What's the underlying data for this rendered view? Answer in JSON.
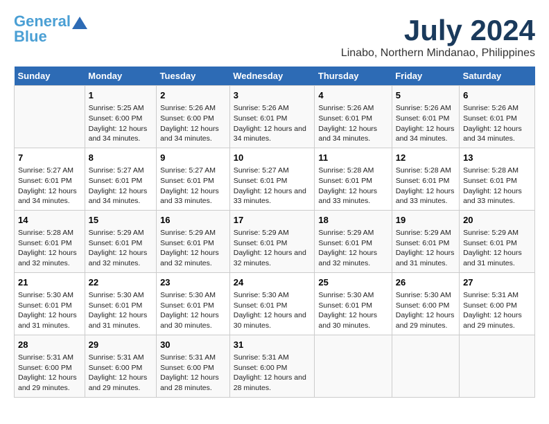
{
  "logo": {
    "line1": "General",
    "line2": "Blue"
  },
  "title": "July 2024",
  "subtitle": "Linabo, Northern Mindanao, Philippines",
  "days_header": [
    "Sunday",
    "Monday",
    "Tuesday",
    "Wednesday",
    "Thursday",
    "Friday",
    "Saturday"
  ],
  "weeks": [
    [
      {
        "day": "",
        "content": ""
      },
      {
        "day": "1",
        "content": "Sunrise: 5:25 AM\nSunset: 6:00 PM\nDaylight: 12 hours\nand 34 minutes."
      },
      {
        "day": "2",
        "content": "Sunrise: 5:26 AM\nSunset: 6:00 PM\nDaylight: 12 hours\nand 34 minutes."
      },
      {
        "day": "3",
        "content": "Sunrise: 5:26 AM\nSunset: 6:01 PM\nDaylight: 12 hours\nand 34 minutes."
      },
      {
        "day": "4",
        "content": "Sunrise: 5:26 AM\nSunset: 6:01 PM\nDaylight: 12 hours\nand 34 minutes."
      },
      {
        "day": "5",
        "content": "Sunrise: 5:26 AM\nSunset: 6:01 PM\nDaylight: 12 hours\nand 34 minutes."
      },
      {
        "day": "6",
        "content": "Sunrise: 5:26 AM\nSunset: 6:01 PM\nDaylight: 12 hours\nand 34 minutes."
      }
    ],
    [
      {
        "day": "7",
        "content": "Sunrise: 5:27 AM\nSunset: 6:01 PM\nDaylight: 12 hours\nand 34 minutes."
      },
      {
        "day": "8",
        "content": "Sunrise: 5:27 AM\nSunset: 6:01 PM\nDaylight: 12 hours\nand 34 minutes."
      },
      {
        "day": "9",
        "content": "Sunrise: 5:27 AM\nSunset: 6:01 PM\nDaylight: 12 hours\nand 33 minutes."
      },
      {
        "day": "10",
        "content": "Sunrise: 5:27 AM\nSunset: 6:01 PM\nDaylight: 12 hours\nand 33 minutes."
      },
      {
        "day": "11",
        "content": "Sunrise: 5:28 AM\nSunset: 6:01 PM\nDaylight: 12 hours\nand 33 minutes."
      },
      {
        "day": "12",
        "content": "Sunrise: 5:28 AM\nSunset: 6:01 PM\nDaylight: 12 hours\nand 33 minutes."
      },
      {
        "day": "13",
        "content": "Sunrise: 5:28 AM\nSunset: 6:01 PM\nDaylight: 12 hours\nand 33 minutes."
      }
    ],
    [
      {
        "day": "14",
        "content": "Sunrise: 5:28 AM\nSunset: 6:01 PM\nDaylight: 12 hours\nand 32 minutes."
      },
      {
        "day": "15",
        "content": "Sunrise: 5:29 AM\nSunset: 6:01 PM\nDaylight: 12 hours\nand 32 minutes."
      },
      {
        "day": "16",
        "content": "Sunrise: 5:29 AM\nSunset: 6:01 PM\nDaylight: 12 hours\nand 32 minutes."
      },
      {
        "day": "17",
        "content": "Sunrise: 5:29 AM\nSunset: 6:01 PM\nDaylight: 12 hours\nand 32 minutes."
      },
      {
        "day": "18",
        "content": "Sunrise: 5:29 AM\nSunset: 6:01 PM\nDaylight: 12 hours\nand 32 minutes."
      },
      {
        "day": "19",
        "content": "Sunrise: 5:29 AM\nSunset: 6:01 PM\nDaylight: 12 hours\nand 31 minutes."
      },
      {
        "day": "20",
        "content": "Sunrise: 5:29 AM\nSunset: 6:01 PM\nDaylight: 12 hours\nand 31 minutes."
      }
    ],
    [
      {
        "day": "21",
        "content": "Sunrise: 5:30 AM\nSunset: 6:01 PM\nDaylight: 12 hours\nand 31 minutes."
      },
      {
        "day": "22",
        "content": "Sunrise: 5:30 AM\nSunset: 6:01 PM\nDaylight: 12 hours\nand 31 minutes."
      },
      {
        "day": "23",
        "content": "Sunrise: 5:30 AM\nSunset: 6:01 PM\nDaylight: 12 hours\nand 30 minutes."
      },
      {
        "day": "24",
        "content": "Sunrise: 5:30 AM\nSunset: 6:01 PM\nDaylight: 12 hours\nand 30 minutes."
      },
      {
        "day": "25",
        "content": "Sunrise: 5:30 AM\nSunset: 6:01 PM\nDaylight: 12 hours\nand 30 minutes."
      },
      {
        "day": "26",
        "content": "Sunrise: 5:30 AM\nSunset: 6:00 PM\nDaylight: 12 hours\nand 29 minutes."
      },
      {
        "day": "27",
        "content": "Sunrise: 5:31 AM\nSunset: 6:00 PM\nDaylight: 12 hours\nand 29 minutes."
      }
    ],
    [
      {
        "day": "28",
        "content": "Sunrise: 5:31 AM\nSunset: 6:00 PM\nDaylight: 12 hours\nand 29 minutes."
      },
      {
        "day": "29",
        "content": "Sunrise: 5:31 AM\nSunset: 6:00 PM\nDaylight: 12 hours\nand 29 minutes."
      },
      {
        "day": "30",
        "content": "Sunrise: 5:31 AM\nSunset: 6:00 PM\nDaylight: 12 hours\nand 28 minutes."
      },
      {
        "day": "31",
        "content": "Sunrise: 5:31 AM\nSunset: 6:00 PM\nDaylight: 12 hours\nand 28 minutes."
      },
      {
        "day": "",
        "content": ""
      },
      {
        "day": "",
        "content": ""
      },
      {
        "day": "",
        "content": ""
      }
    ]
  ]
}
